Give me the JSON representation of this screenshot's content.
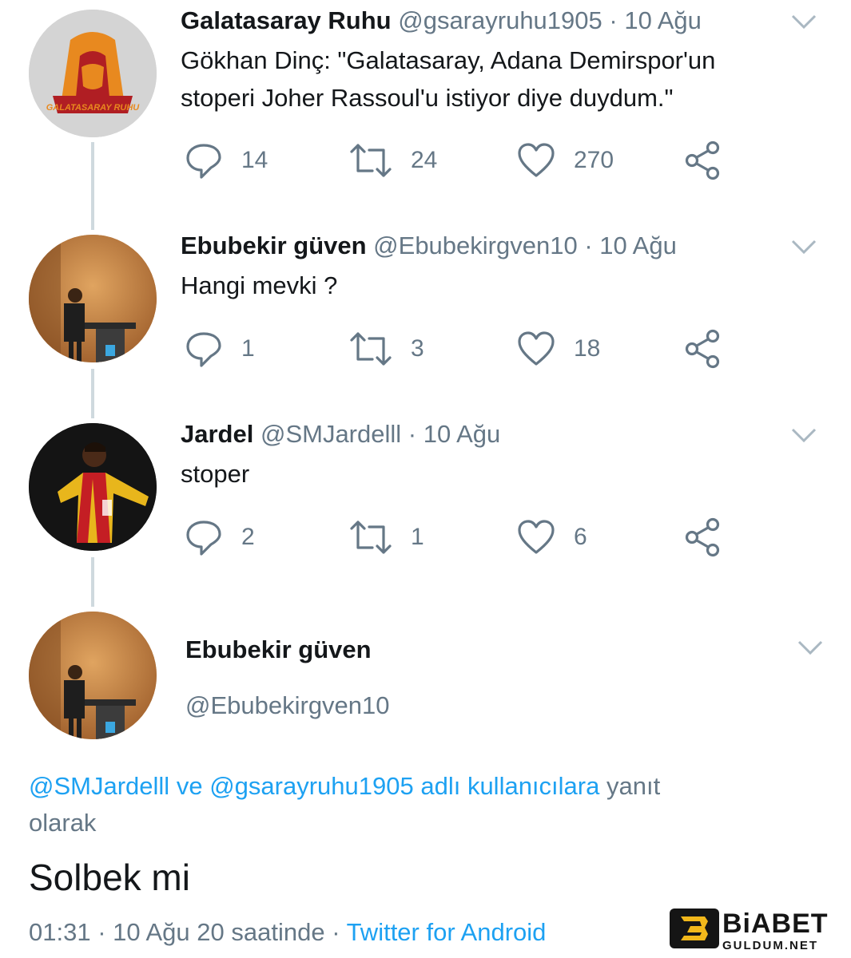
{
  "tweets": [
    {
      "name": "Galatasaray Ruhu",
      "handle": "@gsarayruhu1905",
      "time": "· 10 Ağu",
      "text_lines": [
        "Gökhan Dinç: \"Galatasaray, Adana Demirspor'un",
        "stoperi Joher Rassoul'u istiyor diye duydum.\""
      ],
      "replies": "14",
      "retweets": "24",
      "likes": "270",
      "avatar_label": "GALATASARAY RUHU"
    },
    {
      "name": "Ebubekir güven",
      "handle": "@Ebubekirgven10",
      "time": "· 10 Ağu",
      "text_lines": [
        "Hangi mevki ?"
      ],
      "replies": "1",
      "retweets": "3",
      "likes": "18"
    },
    {
      "name": "Jardel",
      "handle": "@SMJardelll",
      "time": "· 10 Ağu",
      "text_lines": [
        "stoper"
      ],
      "replies": "2",
      "retweets": "1",
      "likes": "6"
    }
  ],
  "main_tweet": {
    "name": "Ebubekir güven",
    "handle": "@Ebubekirgven10",
    "reply_mention_1": "@SMJardelll",
    "reply_ve": "ve",
    "reply_mention_2": "@gsarayruhu1905",
    "reply_users_word": "adlı kullanıcılara",
    "reply_tail_1": "yanıt",
    "reply_tail_2": "olarak",
    "text": "Solbek mi",
    "timestamp": "01:31 · 10 Ağu 20 saatinde ·",
    "source": "Twitter for Android"
  },
  "watermark": {
    "brand": "BiABET",
    "sub": "GULDUM.NET"
  },
  "colors": {
    "link": "#1da1f2",
    "muted": "#657786",
    "thread_line": "#cfd9de",
    "avatar_orange": "#e45a1b",
    "avatar_red": "#b01e23"
  }
}
